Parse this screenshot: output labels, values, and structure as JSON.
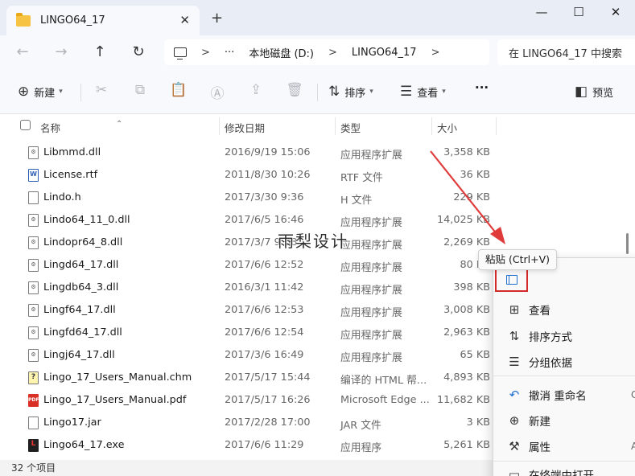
{
  "window": {
    "tab_title": "LINGO64_17",
    "tab_close": "✕",
    "new_tab": "+",
    "minimize": "—",
    "maximize": "☐",
    "close": "✕"
  },
  "address_bar": {
    "back": "←",
    "forward": "→",
    "up": "↑",
    "refresh": "↻",
    "overflow": "···",
    "drive": "本地磁盘 (D:)",
    "folder": "LINGO64_17",
    "separator": ">",
    "search_placeholder": "在 LINGO64_17 中搜索"
  },
  "command_bar": {
    "new_label": "新建",
    "sort_label": "排序",
    "view_label": "查看",
    "more": "···",
    "preview_label": "预览"
  },
  "columns": {
    "name": "名称",
    "date": "修改日期",
    "type": "类型",
    "size": "大小"
  },
  "files": [
    {
      "name": "Libmmd.dll",
      "date": "2016/9/19 15:06",
      "type": "应用程序扩展",
      "size": "3,358 KB",
      "icon": "dll"
    },
    {
      "name": "License.rtf",
      "date": "2011/8/30 10:26",
      "type": "RTF 文件",
      "size": "36 KB",
      "icon": "rtf"
    },
    {
      "name": "Lindo.h",
      "date": "2017/3/30 9:36",
      "type": "H 文件",
      "size": "229 KB",
      "icon": "file"
    },
    {
      "name": "Lindo64_11_0.dll",
      "date": "2017/6/5 16:46",
      "type": "应用程序扩展",
      "size": "14,025 KB",
      "icon": "dll"
    },
    {
      "name": "Lindopr64_8.dll",
      "date": "2017/3/7 9:08",
      "type": "应用程序扩展",
      "size": "2,269 KB",
      "icon": "dll"
    },
    {
      "name": "Lingd64_17.dll",
      "date": "2017/6/6 12:52",
      "type": "应用程序扩展",
      "size": "80 KB",
      "icon": "dll"
    },
    {
      "name": "Lingdb64_3.dll",
      "date": "2016/3/1 11:42",
      "type": "应用程序扩展",
      "size": "398 KB",
      "icon": "dll"
    },
    {
      "name": "Lingf64_17.dll",
      "date": "2017/6/6 12:53",
      "type": "应用程序扩展",
      "size": "3,008 KB",
      "icon": "dll"
    },
    {
      "name": "Lingfd64_17.dll",
      "date": "2017/6/6 12:54",
      "type": "应用程序扩展",
      "size": "2,963 KB",
      "icon": "dll"
    },
    {
      "name": "Lingj64_17.dll",
      "date": "2017/3/6 16:49",
      "type": "应用程序扩展",
      "size": "65 KB",
      "icon": "dll"
    },
    {
      "name": "Lingo_17_Users_Manual.chm",
      "date": "2017/5/17 15:44",
      "type": "编译的 HTML 帮...",
      "size": "4,893 KB",
      "icon": "chm"
    },
    {
      "name": "Lingo_17_Users_Manual.pdf",
      "date": "2017/5/17 16:26",
      "type": "Microsoft Edge ...",
      "size": "11,682 KB",
      "icon": "pdf"
    },
    {
      "name": "Lingo17.jar",
      "date": "2017/2/28 17:00",
      "type": "JAR 文件",
      "size": "3 KB",
      "icon": "file"
    },
    {
      "name": "Lingo64_17.exe",
      "date": "2017/6/6 11:29",
      "type": "应用程序",
      "size": "5,261 KB",
      "icon": "exe"
    }
  ],
  "status": {
    "item_count": "32 个项目"
  },
  "watermark": "雨梨设计",
  "context_menu": {
    "tooltip": "粘贴 (Ctrl+V)",
    "items": [
      {
        "label": "查看",
        "glyph": "⊞",
        "key": ""
      },
      {
        "label": "排序方式",
        "glyph": "⇅",
        "key": ""
      },
      {
        "label": "分组依据",
        "glyph": "☰",
        "key": ""
      },
      {
        "label": "撤消 重命名",
        "glyph": "↶",
        "key": "C"
      },
      {
        "label": "新建",
        "glyph": "⊕",
        "key": ""
      },
      {
        "label": "属性",
        "glyph": "🔧",
        "key": "A"
      },
      {
        "label": "在终端中打开",
        "glyph": "▭",
        "key": ""
      }
    ]
  },
  "colors": {
    "accent_blue": "#1f6fd1",
    "highlight_red": "#d42a2a",
    "arrow_red": "#e03b3b"
  }
}
